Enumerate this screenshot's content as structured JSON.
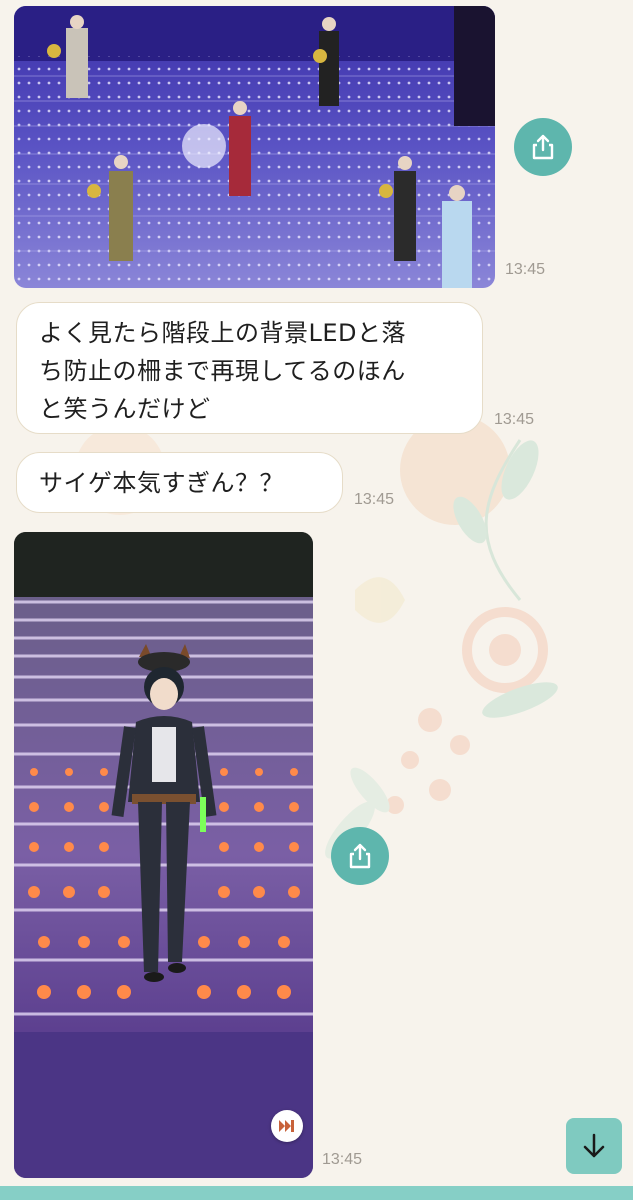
{
  "messages": [
    {
      "type": "image",
      "time": "13:45",
      "description_icon": "stage-photo"
    },
    {
      "type": "text",
      "lines": [
        "よく見たら階段上の背景LEDと落",
        "ち防止の柵まで再現してるのほん",
        "と笑うんだけど"
      ],
      "time": "13:45"
    },
    {
      "type": "text",
      "lines": [
        "サイゲ本気すぎん？？"
      ],
      "time": "13:45"
    },
    {
      "type": "video",
      "time": "13:45"
    }
  ],
  "icons": {
    "share": "share-icon",
    "skip": "fast-forward-icon",
    "scroll": "arrow-down-icon"
  },
  "colors": {
    "accent": "#5eb6ad",
    "background": "#f7f3ec",
    "bubble_border": "#e6dcc8",
    "bottom_bar": "#86cfc6"
  }
}
